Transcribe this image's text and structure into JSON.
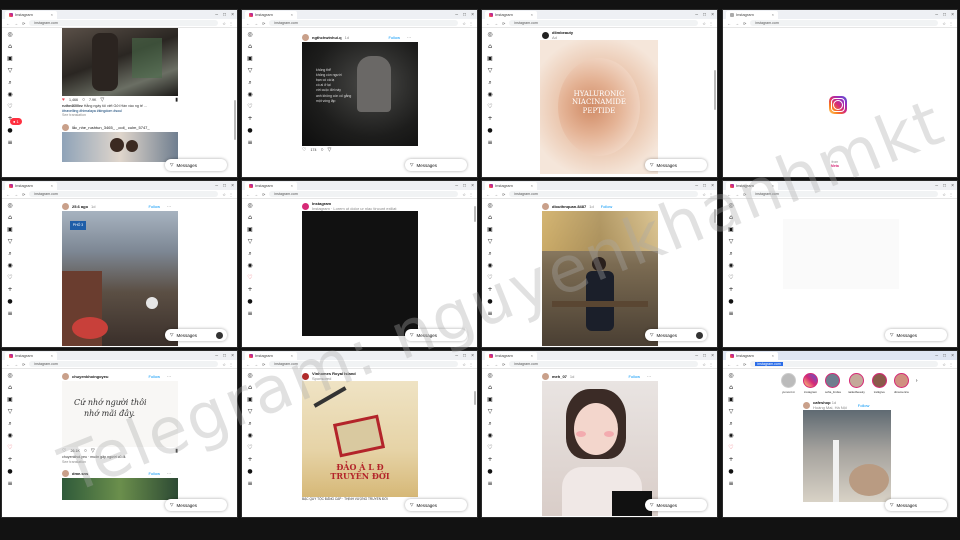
{
  "browser": {
    "tab_title": "Instagram",
    "url": "instagram.com",
    "messages_label": "Messages"
  },
  "windows": {
    "w1": {
      "likes": "1,466",
      "comments": "7.9K",
      "caption_user": "ruthe4600ez",
      "caption_text": "Hằng ngày tôi viết Gửi Hàn vào ng tế ...",
      "hashtags": "#travelling #himalaya #kingdom #soul",
      "see_translation": "See translation",
      "next_user": "lắc_nhe_rushtun_3465_ _ooil_ culm_5747_"
    },
    "w2": {
      "username": "ngthchwinhui.q",
      "time": "1d",
      "follow": "Follow",
      "overlay_lines": [
        "không thể",
        "không còn người",
        "bạn có cà lạ",
        "có ai ở lại",
        "với cuộc đời này",
        "anh không còn cố gắng",
        "một vòng lặp"
      ],
      "likes": "174"
    },
    "w3": {
      "username": "dlimbeauty",
      "sub": "Ad",
      "product_line1": "HYALURONIC",
      "product_line2": "NIACINAMIDE",
      "product_line3": "PEPTIDE"
    },
    "w4": {
      "from": "from",
      "brand": "Meta"
    },
    "w5": {
      "username": "25.6 ago",
      "time": "1d",
      "follow": "Follow",
      "sign": "PHỐ 3"
    },
    "w6": {
      "username": "Instagram",
      "sub": "Instagram · Lorem ut dolor ur nlac tincunt exiliat"
    },
    "w7": {
      "username": "dlouthnquan.8487",
      "time": "1d",
      "follow": "Follow"
    },
    "w8": {},
    "w9": {
      "username": "chuyenkhoingoyeu",
      "follow": "Follow",
      "handwriting_line1": "Cứ nhớ người thôi",
      "handwriting_line2": "nhớ mãi đây.",
      "likes": "26.1K",
      "caption": "chuyenkhoi.yeu · muốn gặp người cũ đi.",
      "see_translation": "See translation",
      "next_user": "dme.sns",
      "next_follow": "Follow"
    },
    "w10": {
      "username": "Vinhomes Royal Island",
      "sub": "Sponsored",
      "title_line1": "ĐẢO Á L Đ",
      "title_line2": "TRUYỀN ĐỜI",
      "footer": "BẬC QUÝ TỘC ĐẲNG CẤP · THỊNH VƯỢNG TRUYỀN ĐỜI"
    },
    "w11": {
      "username": "meh_07",
      "time": "1d",
      "follow": "Follow"
    },
    "w12": {
      "url_selected": "instagram.com",
      "stories": [
        "yumont.in",
        "instagram",
        "sofia_lindsa",
        "nailedbeauty",
        "trelkgive",
        "dinamerica"
      ],
      "username": "cafeshop",
      "time": "1d",
      "follow": "Follow",
      "location": "Hoàng Mai, Hà Nội"
    }
  },
  "watermark": "Telegram: nguyenkhanhmkt",
  "colors": {
    "accent": "#0095f6",
    "notif": "#ff3040",
    "ig_gradient": "#d62976"
  }
}
